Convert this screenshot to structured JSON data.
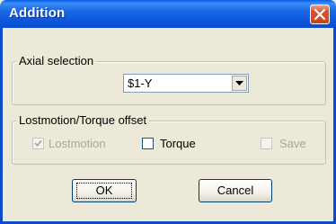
{
  "window": {
    "title": "Addition"
  },
  "axial_selection": {
    "legend": "Axial selection",
    "selected_value": "$1-Y"
  },
  "offset_group": {
    "legend": "Lostmotion/Torque offset",
    "checkboxes": [
      {
        "label": "Lostmotion",
        "checked": true,
        "enabled": false
      },
      {
        "label": "Torque",
        "checked": false,
        "enabled": true
      },
      {
        "label": "Save",
        "checked": false,
        "enabled": false
      }
    ]
  },
  "buttons": {
    "ok_label": "OK",
    "cancel_label": "Cancel"
  },
  "colors": {
    "title_bar": "#0a5ee8",
    "close_button": "#d5562e",
    "dialog_bg": "#ece9d8"
  },
  "icons": {
    "close": "close-icon",
    "dropdown": "chevron-down-icon",
    "check": "checkmark-icon"
  }
}
